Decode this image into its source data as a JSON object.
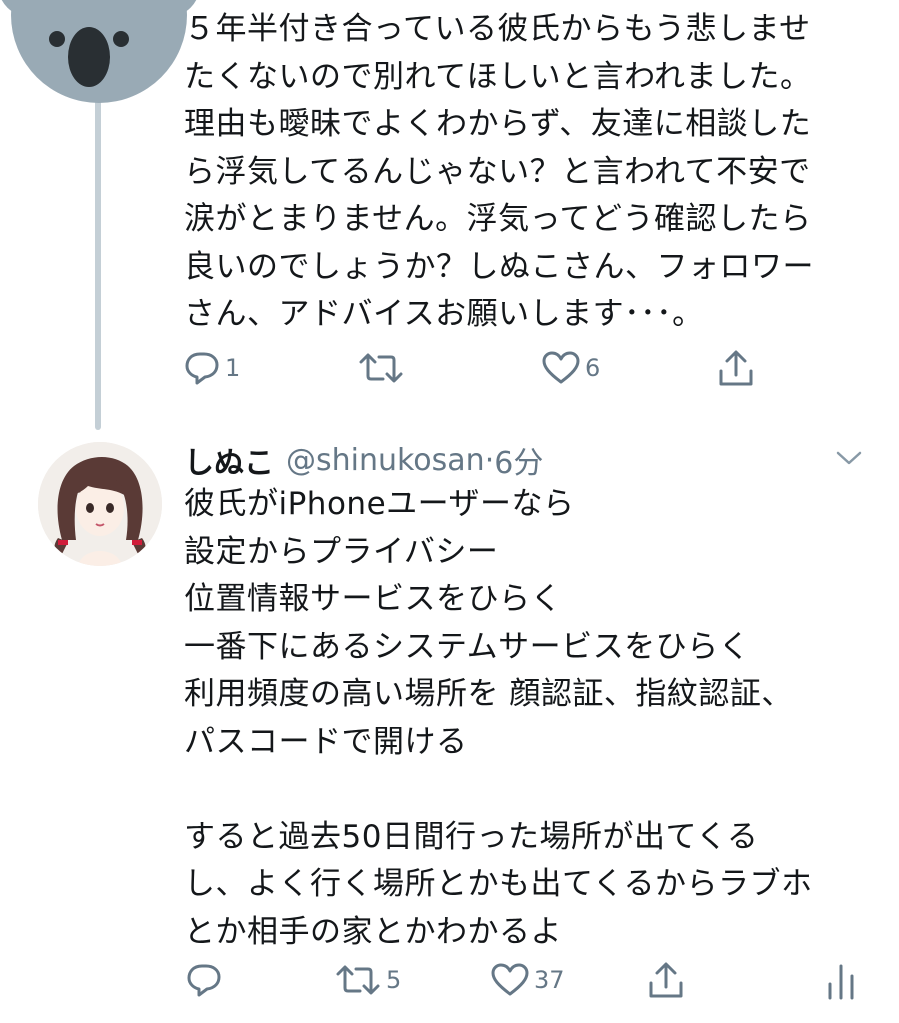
{
  "tweet1": {
    "text": "５年半付き合っている彼氏からもう悲しませ\nたくないので別れてほしいと言われました。\n理由も曖昧でよくわからず、友達に相談した\nら浮気してるんじゃない？と言われて不安で\n涙がとまりません。浮気ってどう確認したら\n良いのでしょうか？しぬこさん、フォロワー\nさん、アドバイスお願いします･･･。",
    "actions": {
      "reply_count": "1",
      "retweet_count": "",
      "like_count": "6"
    }
  },
  "tweet2": {
    "name": "しぬこ",
    "handle": "@shinukosan",
    "dot": "·",
    "time": "6分",
    "text": "彼氏がiPhoneユーザーなら\n設定からプライバシー\n位置情報サービスをひらく\n一番下にあるシステムサービスをひらく\n利用頻度の高い場所を 顔認証、指紋認証、\nパスコードで開ける\n\nすると過去50日間行った場所が出てくる\nし、よく行く場所とかも出てくるからラブホ\nとか相手の家とかわかるよ",
    "actions": {
      "reply_count": "",
      "retweet_count": "5",
      "like_count": "37"
    }
  },
  "colors": {
    "icon_gray": "#657786",
    "text": "#14171a",
    "thread_line": "#c4cfd6",
    "koala": "#99aab5"
  }
}
